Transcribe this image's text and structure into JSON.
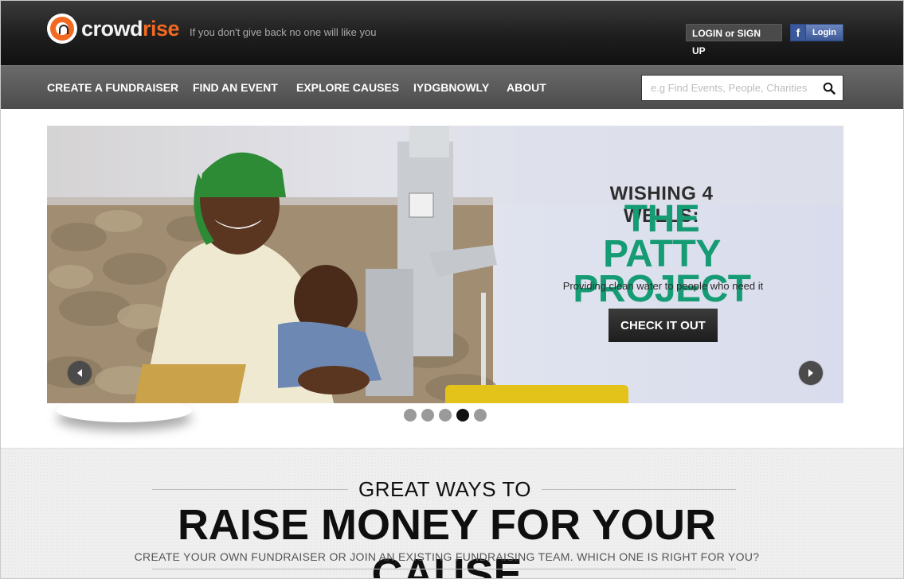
{
  "header": {
    "logo": {
      "part1": "crowd",
      "part2": "rise"
    },
    "tagline": "If you don't give back no one will like you",
    "login_signup": "LOGIN or SIGN UP",
    "fb_login": "Login"
  },
  "nav": {
    "items": [
      "CREATE A FUNDRAISER",
      "FIND AN EVENT",
      "EXPLORE CAUSES",
      "IYDGBNOWLY",
      "ABOUT"
    ],
    "search_placeholder": "e.g Find Events, People, Charities"
  },
  "hero": {
    "title_line1": "WISHING 4 WELLS:",
    "title_line2a": "THE PATTY",
    "title_line2b": "PROJECT",
    "subtitle": "Providing clean water to people who need it",
    "cta": "CHECK IT OUT",
    "slide_count": 5,
    "active_slide": 4
  },
  "section": {
    "kicker": "GREAT WAYS TO",
    "headline": "RAISE MONEY FOR YOUR CAUSE",
    "subline": "CREATE YOUR OWN FUNDRAISER OR JOIN AN EXISTING FUNDRAISING TEAM. WHICH ONE IS RIGHT FOR YOU?"
  },
  "colors": {
    "brand_orange": "#f26a21",
    "accent_green": "#169c74",
    "facebook_blue": "#3b5998"
  }
}
